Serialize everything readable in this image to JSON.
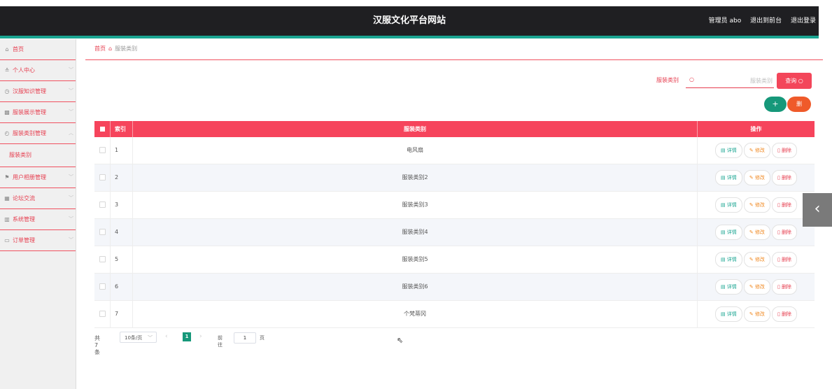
{
  "header": {
    "title": "汉服文化平台网站",
    "admin": "管理员 abo",
    "back_front": "退出到前台",
    "logout": "退出登录"
  },
  "sidebar": {
    "items": [
      {
        "label": "首页",
        "icon": "home-icon"
      },
      {
        "label": "个人中心",
        "icon": "user-icon"
      },
      {
        "label": "汉服知识管理",
        "icon": "clock-icon"
      },
      {
        "label": "服装展示管理",
        "icon": "picture-icon"
      },
      {
        "label": "服装类别管理",
        "icon": "clock-icon",
        "sub": [
          {
            "label": "服装类别"
          }
        ]
      },
      {
        "label": "用户相册管理",
        "icon": "flag-icon"
      },
      {
        "label": "论坛交流",
        "icon": "grid-icon"
      },
      {
        "label": "系统管理",
        "icon": "trash-icon"
      },
      {
        "label": "订单管理",
        "icon": "card-icon"
      }
    ]
  },
  "breadcrumb": {
    "home": "首页",
    "current": "服装类别"
  },
  "search": {
    "label": "服装类别",
    "placeholder": "服装类别",
    "button": "查询"
  },
  "actions": {
    "add": "+",
    "delete": "删"
  },
  "table": {
    "headers": {
      "index": "索引",
      "name": "服装类别",
      "ops": "操作"
    },
    "rows": [
      {
        "index": "1",
        "name": "电风扇"
      },
      {
        "index": "2",
        "name": "服装类别2"
      },
      {
        "index": "3",
        "name": "服装类别3"
      },
      {
        "index": "4",
        "name": "服装类别4"
      },
      {
        "index": "5",
        "name": "服装类别5"
      },
      {
        "index": "6",
        "name": "服装类别6"
      },
      {
        "index": "7",
        "name": "个梵蒂冈"
      }
    ],
    "op_labels": {
      "detail": "详情",
      "edit": "修改",
      "delete": "删除"
    }
  },
  "pagination": {
    "total": "共 7 条",
    "page_size": "10条/页",
    "current": "1",
    "goto": "前往",
    "goto_value": "1",
    "page_unit": "页"
  },
  "colors": {
    "accent": "#f3465a",
    "header_bg": "#1f1f22",
    "teal": "#16987a",
    "orange": "#ef5a2a"
  }
}
